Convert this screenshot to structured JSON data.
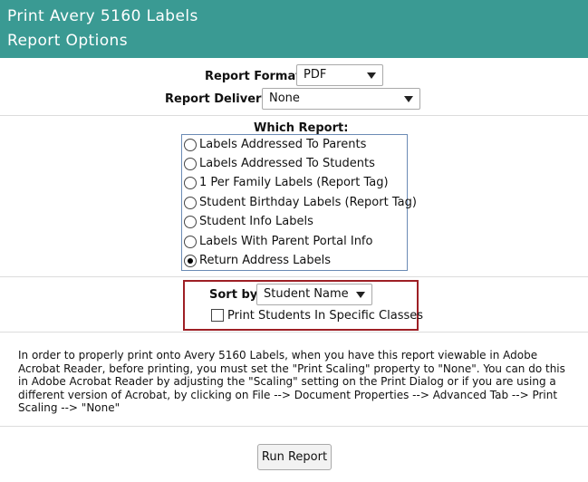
{
  "header": {
    "line1": "Print Avery 5160 Labels",
    "line2": "Report Options"
  },
  "report_format": {
    "label": "Report Format:",
    "value": "PDF"
  },
  "report_delivery": {
    "label": "Report Delivery:",
    "value": "None"
  },
  "which_report": {
    "label": "Which Report:",
    "options": [
      {
        "label": "Labels Addressed To Parents",
        "selected": false
      },
      {
        "label": "Labels Addressed To Students",
        "selected": false
      },
      {
        "label": "1 Per Family Labels (Report Tag)",
        "selected": false
      },
      {
        "label": "Student Birthday Labels (Report Tag)",
        "selected": false
      },
      {
        "label": "Student Info Labels",
        "selected": false
      },
      {
        "label": "Labels With Parent Portal Info",
        "selected": false
      },
      {
        "label": "Return Address Labels",
        "selected": true
      }
    ]
  },
  "sort_by": {
    "label": "Sort by:",
    "value": "Student Name"
  },
  "specific_classes": {
    "label": "Print Students In Specific Classes",
    "checked": false
  },
  "note": "In order to properly print onto Avery 5160 Labels, when you have this report viewable in Adobe Acrobat Reader, before printing, you must set the \"Print Scaling\" property to \"None\". You can do this in Adobe Acrobat Reader by adjusting the \"Scaling\" setting on the Print Dialog or if you are using a different version of Acrobat, by clicking on File --> Document Properties --> Advanced Tab --> Print Scaling --> \"None\"",
  "run_button": "Run Report",
  "colors": {
    "header_bg": "#3a9a93",
    "highlight_border": "#9e1f25"
  }
}
